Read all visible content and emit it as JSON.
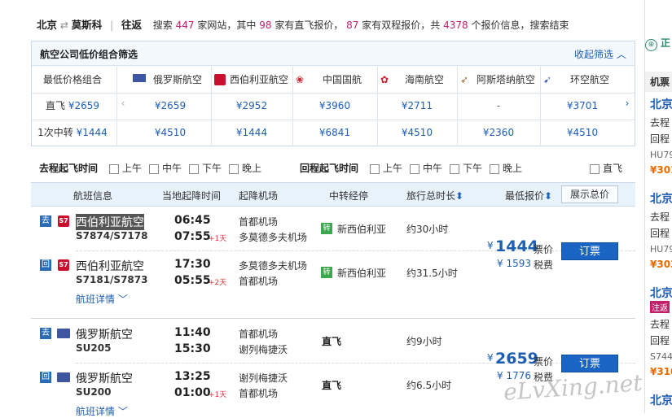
{
  "summary": {
    "from": "北京",
    "to": "莫斯科",
    "trip_type": "往返",
    "text_a": "搜索",
    "sites": "447",
    "text_b": "家网站，其中",
    "direct": "98",
    "text_c": "家有直飞报价，",
    "round": "87",
    "text_d": "家有双程报价，共",
    "quotes": "4378",
    "text_e": "个报价信息，搜索结束"
  },
  "filter": {
    "title": "航空公司低价组合筛选",
    "collapse_label": "收起筛选",
    "row_header": "最低价格组合",
    "row_direct_label": "直飞",
    "row_direct_price": "¥2659",
    "row_transfer_label": "1次中转",
    "row_transfer_price": "¥1444",
    "airlines": [
      {
        "name": "俄罗斯航空",
        "direct": "¥2659",
        "transfer": "¥4510"
      },
      {
        "name": "西伯利亚航空",
        "direct": "¥2952",
        "transfer": "¥1444"
      },
      {
        "name": "中国国航",
        "direct": "¥3960",
        "transfer": "¥6841"
      },
      {
        "name": "海南航空",
        "direct": "¥2711",
        "transfer": "¥4510"
      },
      {
        "name": "阿斯塔纳航空",
        "direct": "-",
        "transfer": "¥2360"
      },
      {
        "name": "环空航空",
        "direct": "¥3701",
        "transfer": "¥4510"
      }
    ]
  },
  "time_filter": {
    "outbound_label": "去程起飞时间",
    "return_label": "回程起飞时间",
    "options": [
      "上午",
      "中午",
      "下午",
      "晚上"
    ],
    "direct_only": "直飞"
  },
  "results": {
    "headers": {
      "flight_info": "航班信息",
      "times": "当地起降时间",
      "airport": "起降机场",
      "transfer": "中转经停",
      "duration": "旅行总时长",
      "price": "最低报价",
      "show_total": "展示总价"
    },
    "tag_out": "去",
    "tag_back": "回",
    "transfer_tag": "转",
    "price_unit": "票价",
    "tax_unit": "税费",
    "book_label": "订票",
    "details_label": "航班详情",
    "groups": [
      {
        "out": {
          "airline": "西伯利亚航空",
          "code": "S7874/S7178",
          "dep": "06:45",
          "arr": "07:55",
          "plus": "+1天",
          "from_ap": "首都机场",
          "to_ap": "多莫德多夫机场",
          "via": "新西伯利亚",
          "duration": "约30小时"
        },
        "back": {
          "airline": "西伯利亚航空",
          "code": "S7181/S7873",
          "dep": "17:30",
          "arr": "05:55",
          "plus": "+2天",
          "from_ap": "多莫德多夫机场",
          "to_ap": "首都机场",
          "via": "新西伯利亚",
          "duration": "约31.5小时"
        },
        "price": "1444",
        "tax": "1593"
      },
      {
        "out": {
          "airline": "俄罗斯航空",
          "code": "SU205",
          "dep": "11:40",
          "arr": "15:30",
          "plus": "",
          "from_ap": "首都机场",
          "to_ap": "谢列梅捷沃",
          "via": "直飞",
          "duration": "约9小时"
        },
        "back": {
          "airline": "俄罗斯航空",
          "code": "SU200",
          "dep": "13:25",
          "arr": "01:00",
          "plus": "+1天",
          "from_ap": "谢列梅捷沃",
          "to_ap": "首都机场",
          "via": "直飞",
          "duration": "约6.5小时"
        },
        "price": "2659",
        "tax": "1776"
      }
    ]
  },
  "right_panel": {
    "top_label": "正",
    "heading": "机票",
    "items": [
      {
        "city": "北京",
        "l1": "去程",
        "l2": "回程",
        "code": "HU79",
        "price": "¥301"
      },
      {
        "city": "北京",
        "l1": "去程",
        "l2": "回程",
        "code": "HU79",
        "price": "¥303"
      },
      {
        "city": "北京",
        "badge": "注返",
        "l1": "去程",
        "l2": "回程",
        "code": "S744",
        "price": "¥310"
      },
      {
        "city": "北京"
      }
    ]
  },
  "watermark": "eLvXing.net",
  "colors": {
    "accent_blue": "#1e5fb3",
    "price_blue": "#1e5fb3",
    "highlight_pink": "#c1206a",
    "button_blue": "#1a64c4"
  }
}
